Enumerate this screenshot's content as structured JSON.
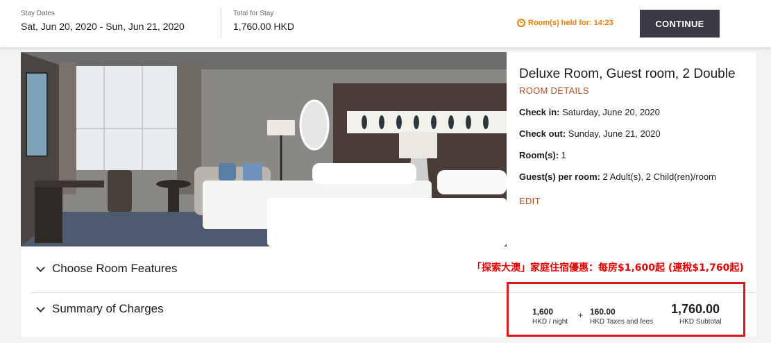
{
  "header": {
    "stay_label": "Stay Dates",
    "stay_value": "Sat, Jun 20, 2020 - Sun, Jun 21, 2020",
    "total_label": "Total for Stay",
    "total_value": "1,760.00 HKD",
    "held_text": "Room(s) held for: 14:23",
    "continue_label": "CONTINUE"
  },
  "room": {
    "title": "Deluxe Room, Guest room, 2 Double",
    "details_link": "ROOM DETAILS",
    "checkin_label": "Check in:",
    "checkin_value": "Saturday, June 20, 2020",
    "checkout_label": "Check out:",
    "checkout_value": "Sunday, June 21, 2020",
    "rooms_label": "Room(s):",
    "rooms_value": "1",
    "guests_label": "Guest(s) per room:",
    "guests_value": "2 Adult(s), 2 Child(ren)/room",
    "edit_link": "EDIT"
  },
  "sections": {
    "features": "Choose Room Features",
    "summary": "Summary of Charges"
  },
  "promo": "「探索大澳」家庭住宿優惠：每房$1,600起 (連稅$1,760起)",
  "charges": {
    "nightly": "1,600",
    "nightly_unit": "HKD / night",
    "plus": "+",
    "taxes": "160.00",
    "taxes_unit": "HKD Taxes and fees",
    "subtotal": "1,760.00",
    "subtotal_unit": "HKD Subtotal"
  },
  "colors": {
    "accent_orange": "#ef7d00",
    "link_rust": "#b34d1f",
    "button_dark": "#3b3a44",
    "promo_red": "#e60000"
  }
}
